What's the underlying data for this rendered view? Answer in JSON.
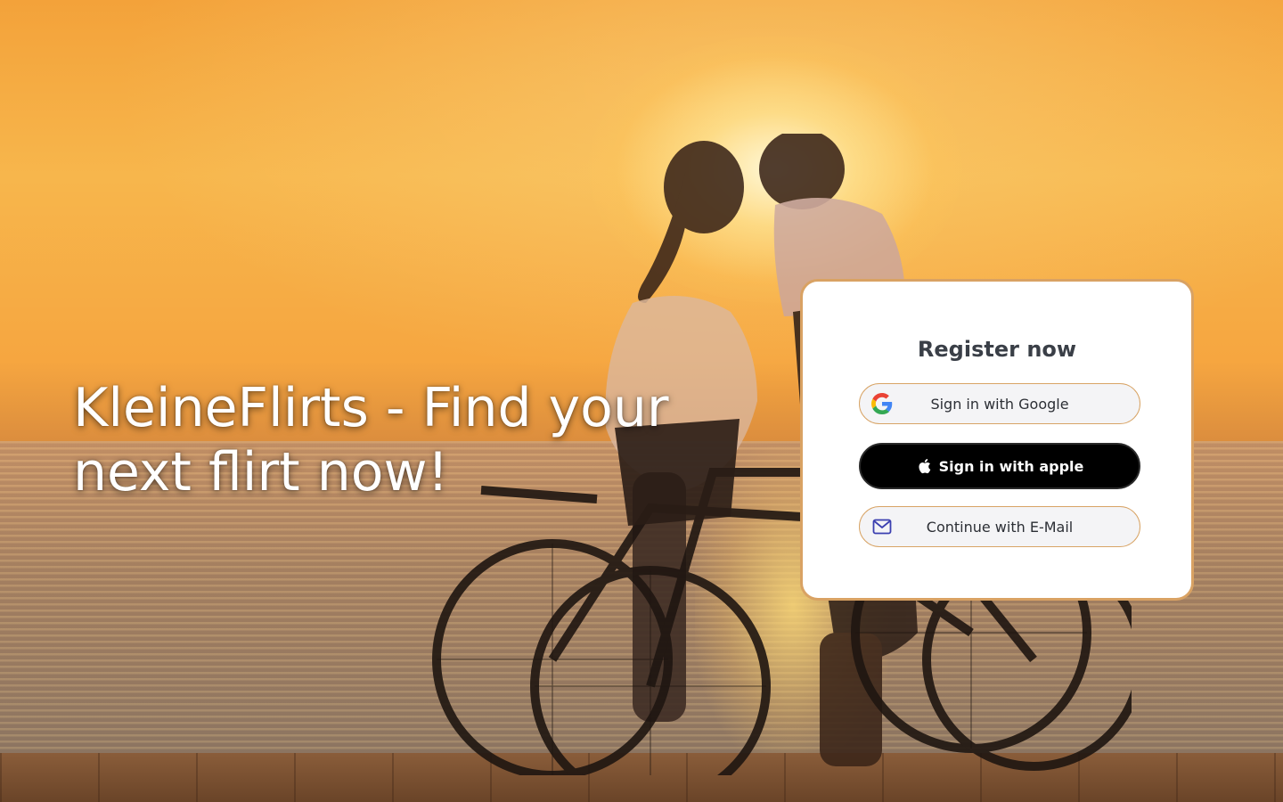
{
  "hero": {
    "line1": "KleineFlirts - Find your",
    "line2": "next flirt now!"
  },
  "register_card": {
    "title": "Register now",
    "google_label": "Sign in with Google",
    "apple_label": "Sign in with apple",
    "email_label": "Continue with E-Mail"
  },
  "icons": {
    "google": "google-logo-icon",
    "apple": "apple-logo-icon",
    "email": "envelope-icon"
  },
  "colors": {
    "card_border": "#d9a263",
    "apple_button": "#000000",
    "title_text": "#3a3f47"
  }
}
